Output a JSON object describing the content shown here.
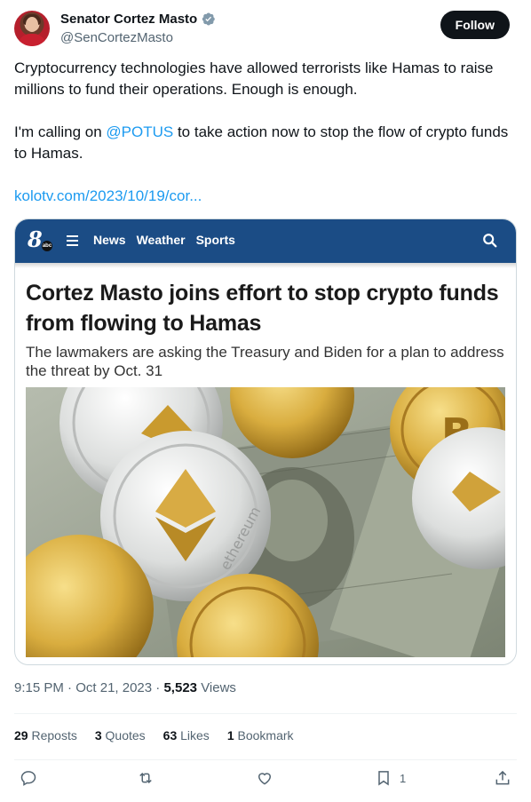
{
  "author": {
    "display_name": "Senator Cortez Masto",
    "handle": "@SenCortezMasto",
    "follow_label": "Follow"
  },
  "tweet": {
    "paragraph1": "Cryptocurrency technologies have allowed terrorists like Hamas to raise millions to fund their operations. Enough is enough.",
    "paragraph2_before": "I'm calling on ",
    "mention": "@POTUS",
    "paragraph2_after": " to take action now to stop the flow of crypto funds to Hamas.",
    "link": "kolotv.com/2023/10/19/cor..."
  },
  "card": {
    "logo_number": "8",
    "logo_network": "abc",
    "nav": [
      "News",
      "Weather",
      "Sports"
    ],
    "headline": "Cortez Masto joins effort to stop crypto funds from flowing to Hamas",
    "subhead": "The lawmakers are asking the Treasury and Biden for a plan to address the threat by Oct. 31",
    "photo_text": "ethereum"
  },
  "meta": {
    "time": "9:15 PM",
    "date": "Oct 21, 2023",
    "views_count": "5,523",
    "views_label": "Views"
  },
  "stats": {
    "reposts_count": "29",
    "reposts_label": "Reposts",
    "quotes_count": "3",
    "quotes_label": "Quotes",
    "likes_count": "63",
    "likes_label": "Likes",
    "bookmarks_count": "1",
    "bookmarks_label": "Bookmark"
  },
  "actions": {
    "bookmark_count": "1"
  },
  "colors": {
    "accent": "#1d9bf0",
    "text": "#0f1419",
    "muted": "#536471",
    "news_nav": "#1b4c85"
  },
  "icons": [
    "verified-badge-icon",
    "hamburger-menu-icon",
    "search-icon",
    "reply-icon",
    "repost-icon",
    "like-icon",
    "bookmark-icon",
    "share-icon"
  ]
}
